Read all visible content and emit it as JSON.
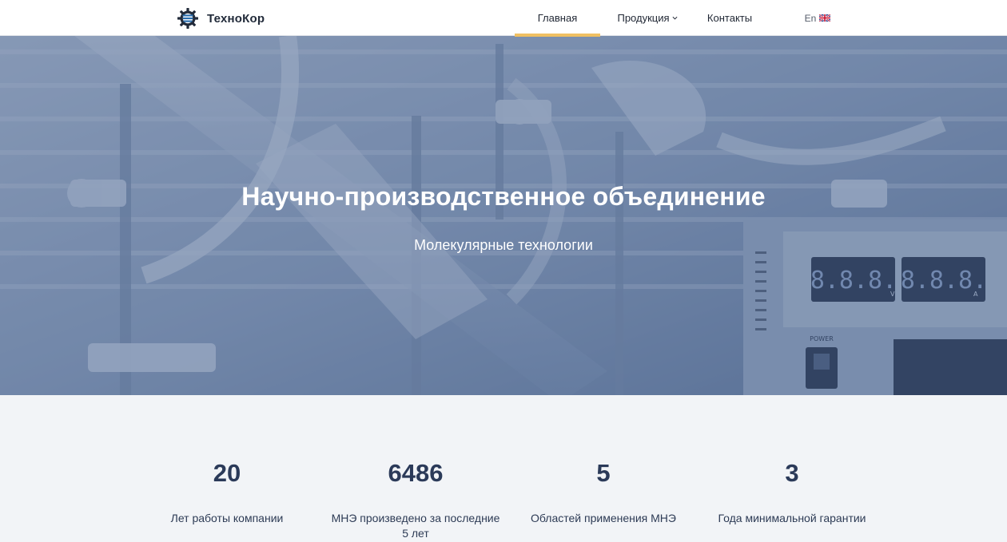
{
  "header": {
    "brand": "ТехноКор",
    "nav": {
      "home": "Главная",
      "products": "Продукция",
      "contacts": "Контакты",
      "lang": "En"
    },
    "active_tab": "home",
    "accent_color": "#f0c062"
  },
  "hero": {
    "title": "Научно-производственное объединение",
    "subtitle": "Молекулярные технологии",
    "overlay_color": "#3a5482"
  },
  "stats": [
    {
      "value": "20",
      "label": "Лет работы компании"
    },
    {
      "value": "6486",
      "label": "МНЭ произведено за последние 5 лет"
    },
    {
      "value": "5",
      "label": "Областей применения МНЭ"
    },
    {
      "value": "3",
      "label": "Года минимальной гарантии"
    }
  ],
  "device_readout": {
    "left": "8.8.8.",
    "right": "8.8.8.",
    "unit_left": "V",
    "unit_right": "A",
    "power_label": "POWER"
  },
  "icons": [
    "gear-logo-icon",
    "chevron-down-icon",
    "uk-flag-icon"
  ]
}
